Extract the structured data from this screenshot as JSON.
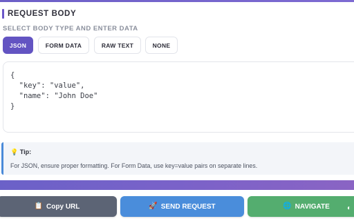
{
  "section": {
    "title": "REQUEST BODY",
    "subtitle": "SELECT BODY TYPE AND ENTER DATA"
  },
  "body_types": {
    "json": "JSON",
    "form_data": "FORM DATA",
    "raw_text": "RAW TEXT",
    "none": "NONE",
    "selected": "JSON"
  },
  "editor": {
    "value": "{\n  \"key\": \"value\",\n  \"name\": \"John Doe\"\n}"
  },
  "tip": {
    "icon": "lightbulb-icon",
    "label": "Tip:",
    "text": "For JSON, ensure proper formatting. For Form Data, use key=value pairs on separate lines."
  },
  "actions": {
    "copy_label": "Copy URL",
    "copy_icon": "clipboard-icon",
    "send_label": "SEND REQUEST",
    "send_icon": "rocket-icon",
    "navigate_label": "NAVIGATE",
    "navigate_icon": "globe-icon"
  },
  "colors": {
    "accent": "#6354c2",
    "send": "#4a8ddb",
    "navigate": "#54ad6f",
    "copy": "#5c6475",
    "tip_border": "#4a8ad8"
  }
}
